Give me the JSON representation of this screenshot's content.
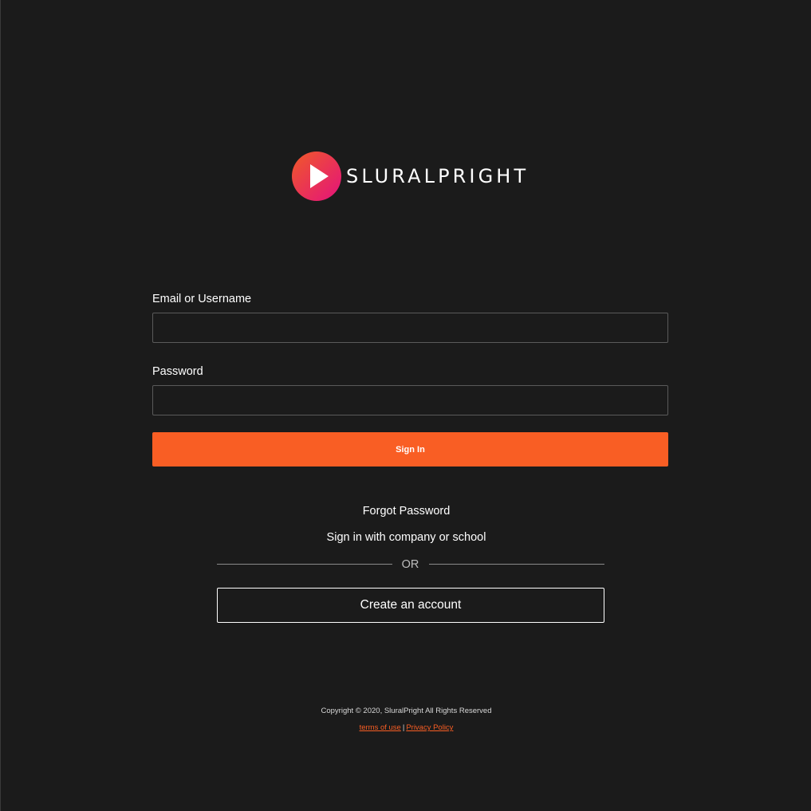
{
  "brand": {
    "name": "SLURALPRIGHT",
    "logo_icon": "play-circle-icon",
    "colors": {
      "logo_gradient_start": "#f05a28",
      "logo_gradient_end": "#e4127c"
    }
  },
  "form": {
    "email_label": "Email or Username",
    "email_value": "",
    "password_label": "Password",
    "password_value": "",
    "sign_in_label": "Sign In"
  },
  "links": {
    "forgot_password": "Forgot Password",
    "company_sign_in": "Sign in with company or school",
    "or": "OR",
    "create_account": "Create an account"
  },
  "footer": {
    "copyright": "Copyright © 2020, SluralPright All Rights Reserved",
    "terms": "terms of use",
    "separator": "|",
    "privacy": "Privacy Policy"
  },
  "colors": {
    "background": "#1b1b1b",
    "accent": "#f95e24"
  }
}
